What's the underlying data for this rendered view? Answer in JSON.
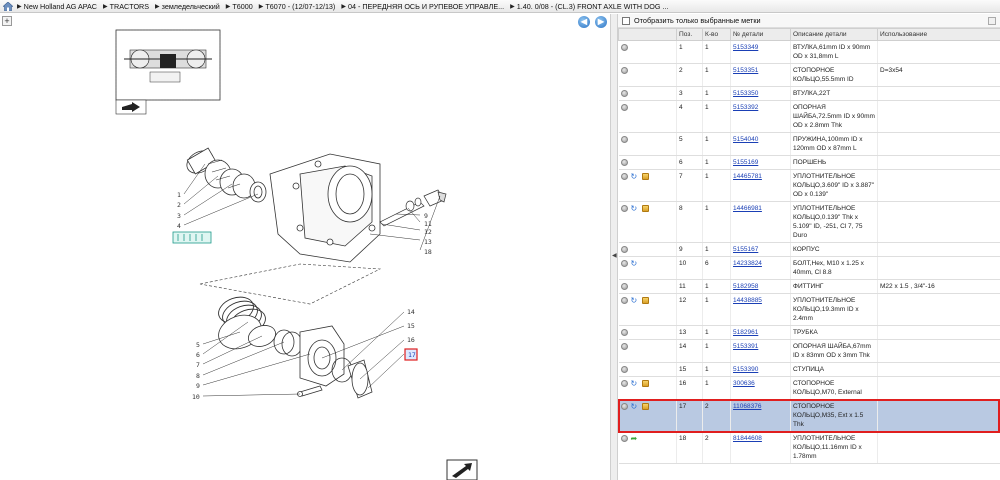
{
  "breadcrumb": [
    "New Holland AG APAC",
    "TRACTORS",
    "земледельческий",
    "T6000",
    "T6070 - (12/07-12/13)",
    "04 - ПЕРЕДНЯЯ ОСЬ И РУПЕВОЕ УПРАВЛЕ...",
    "1.40. 0/08 - (CL.3) FRONT AXLE WITH DOG ..."
  ],
  "filter": {
    "label": "Отобразить только выбранные метки"
  },
  "columns": [
    "Поз.",
    "К-во",
    "№ детали",
    "Описание детали",
    "Использование"
  ],
  "rows": [
    {
      "pos": "1",
      "qty": "1",
      "part": "5153349",
      "desc": "ВТУЛКА,61mm ID x 90mm OD x 31,8mm L",
      "use": "",
      "icons": [
        "info"
      ]
    },
    {
      "pos": "2",
      "qty": "1",
      "part": "5153351",
      "desc": "СТОПОРНОЕ КОЛЬЦО,55.5mm ID",
      "use": "D=3x54",
      "icons": [
        "info"
      ]
    },
    {
      "pos": "3",
      "qty": "1",
      "part": "5153350",
      "desc": "ВТУЛКА,22T",
      "use": "",
      "icons": [
        "info"
      ]
    },
    {
      "pos": "4",
      "qty": "1",
      "part": "5153392",
      "desc": "ОПОРНАЯ ШАЙБА,72.5mm ID x 90mm OD x 2.8mm Thk",
      "use": "",
      "icons": [
        "info"
      ]
    },
    {
      "pos": "5",
      "qty": "1",
      "part": "5154040",
      "desc": "ПРУЖИНА,100mm ID x 120mm OD x 87mm L",
      "use": "",
      "icons": [
        "info"
      ]
    },
    {
      "pos": "6",
      "qty": "1",
      "part": "5155169",
      "desc": "ПОРШЕНЬ",
      "use": "",
      "icons": [
        "info"
      ]
    },
    {
      "pos": "7",
      "qty": "1",
      "part": "14465781",
      "desc": "УПЛОТНИТЕЛЬНОЕ КОЛЬЦО,3.609\" ID x 3.887\" OD x 0.139\"",
      "use": "",
      "icons": [
        "info",
        "cycle",
        "box"
      ]
    },
    {
      "pos": "8",
      "qty": "1",
      "part": "14466981",
      "desc": "УПЛОТНИТЕЛЬНОЕ КОЛЬЦО,0.139\" Thk x 5.109\" ID, -251, Cl 7, 75 Duro",
      "use": "",
      "icons": [
        "info",
        "cycle",
        "box"
      ]
    },
    {
      "pos": "9",
      "qty": "1",
      "part": "5155167",
      "desc": "КОРПУС",
      "use": "",
      "icons": [
        "info"
      ]
    },
    {
      "pos": "10",
      "qty": "6",
      "part": "14233824",
      "desc": "БОЛТ,Hex, M10 x 1.25 x 40mm, Cl 8.8",
      "use": "",
      "icons": [
        "info",
        "cycle"
      ]
    },
    {
      "pos": "11",
      "qty": "1",
      "part": "5182958",
      "desc": "ФИТТИНГ",
      "use": "M22 x 1.5 , 3/4\"-16",
      "icons": [
        "info"
      ]
    },
    {
      "pos": "12",
      "qty": "1",
      "part": "14438885",
      "desc": "УПЛОТНИТЕЛЬНОЕ КОЛЬЦО,19.3mm ID x 2.4mm",
      "use": "",
      "icons": [
        "info",
        "cycle",
        "box"
      ]
    },
    {
      "pos": "13",
      "qty": "1",
      "part": "5182961",
      "desc": "ТРУБКА",
      "use": "",
      "icons": [
        "info"
      ]
    },
    {
      "pos": "14",
      "qty": "1",
      "part": "5153391",
      "desc": "ОПОРНАЯ ШАЙБА,67mm ID x 83mm OD x 3mm Thk",
      "use": "",
      "icons": [
        "info"
      ]
    },
    {
      "pos": "15",
      "qty": "1",
      "part": "5153390",
      "desc": "СТУПИЦА",
      "use": "",
      "icons": [
        "info"
      ]
    },
    {
      "pos": "16",
      "qty": "1",
      "part": "300636",
      "desc": "СТОПОРНОЕ КОЛЬЦО,M70, External",
      "use": "",
      "icons": [
        "info",
        "cycle",
        "box"
      ]
    },
    {
      "pos": "17",
      "qty": "2",
      "part": "11068376",
      "desc": "СТОПОРНОЕ КОЛЬЦО,M35, Ext x 1.5 Thk",
      "use": "",
      "icons": [
        "info",
        "cycle",
        "box"
      ],
      "selected": true
    },
    {
      "pos": "18",
      "qty": "2",
      "part": "81844608",
      "desc": "УПЛОТНИТЕЛЬНОЕ КОЛЬЦО,11.16mm ID x 1.78mm",
      "use": "",
      "icons": [
        "info",
        "arrow"
      ]
    }
  ],
  "callouts": {
    "left_top": [
      "1",
      "2",
      "3",
      "4"
    ],
    "right_top": [
      "9",
      "11",
      "12",
      "13",
      "18"
    ],
    "left_bottom": [
      "5",
      "6",
      "7",
      "8",
      "9",
      "10"
    ],
    "right_bottom": [
      "14",
      "15",
      "16",
      "17"
    ],
    "highlight_top": "18",
    "highlight_bottom": "17"
  },
  "icons": {
    "home": "home-icon",
    "back": "arrow-left-icon",
    "forward": "arrow-right-icon",
    "add": "plus-icon",
    "collapse": "chevron-left-icon"
  },
  "colors": {
    "selection_border": "#e01e1e",
    "selected_row": "#b9c9e2",
    "link": "#1a3fb5"
  }
}
